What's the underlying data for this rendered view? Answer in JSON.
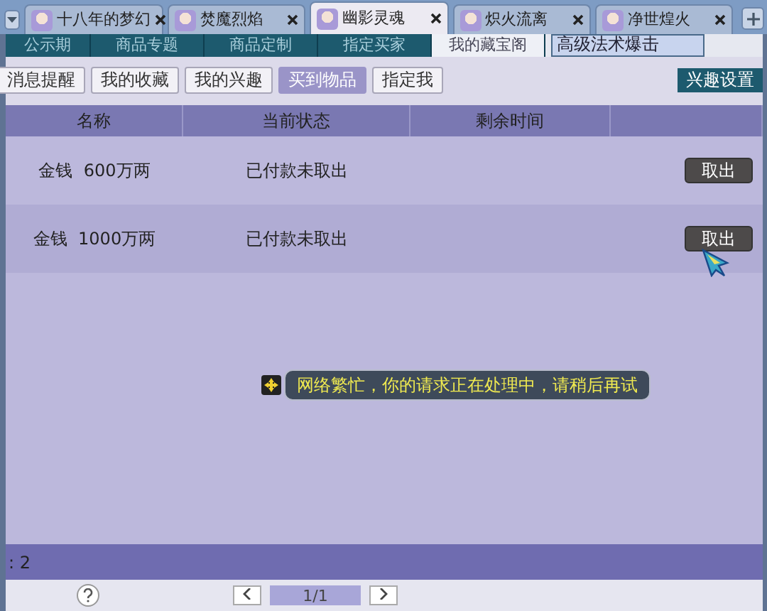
{
  "browser_tabs": [
    {
      "title": "十八年的梦幻",
      "selected": false
    },
    {
      "title": "焚魔烈焰",
      "selected": false
    },
    {
      "title": "幽影灵魂",
      "selected": true
    },
    {
      "title": "炽火流离",
      "selected": false
    },
    {
      "title": "净世煌火",
      "selected": false
    }
  ],
  "nav": [
    {
      "label": "公示期",
      "selected": false
    },
    {
      "label": "商品专题",
      "selected": false
    },
    {
      "label": "商品定制",
      "selected": false
    },
    {
      "label": "指定买家",
      "selected": false
    },
    {
      "label": "我的藏宝阁",
      "selected": true
    }
  ],
  "search": {
    "value": "高级法术爆击"
  },
  "filters": [
    {
      "label": "消息提醒",
      "selected": false
    },
    {
      "label": "我的收藏",
      "selected": false
    },
    {
      "label": "我的兴趣",
      "selected": false
    },
    {
      "label": "买到物品",
      "selected": true
    },
    {
      "label": "指定我",
      "selected": false
    }
  ],
  "settings_button": "兴趣设置",
  "table": {
    "columns": [
      "名称",
      "当前状态",
      "剩余时间"
    ],
    "rows": [
      {
        "name": "金钱  600万两",
        "status": "已付款未取出",
        "action": "取出"
      },
      {
        "name": "金钱  1000万两",
        "status": "已付款未取出",
        "action": "取出"
      }
    ]
  },
  "toast": "网络繁忙，你的请求正在处理中，请稍后再试",
  "count": ": 2",
  "pager": {
    "page": "1/1"
  }
}
